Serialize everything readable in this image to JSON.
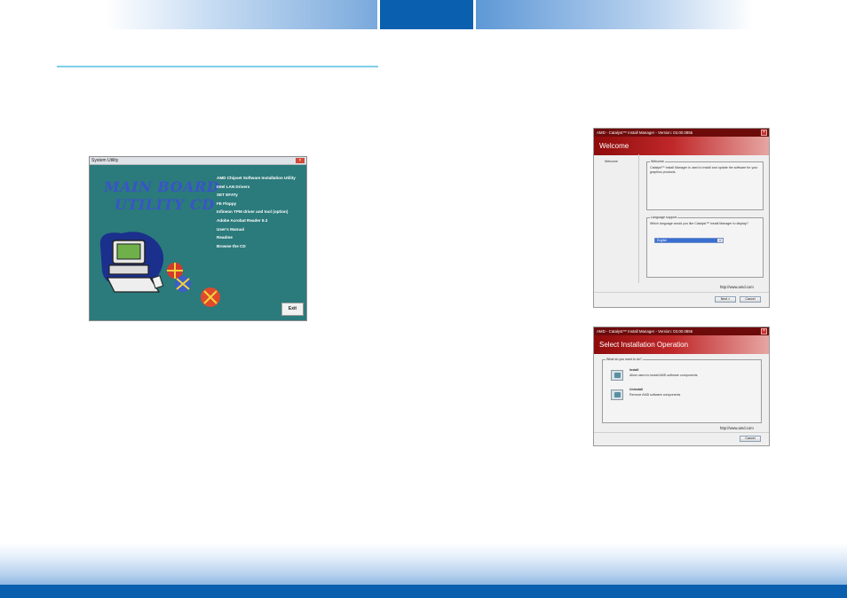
{
  "system_utility": {
    "window_title": "System Utility",
    "close_glyph": "×",
    "cd_title_line1": "MAIN BOARD",
    "cd_title_line2": "UTILITY  CD",
    "menu": [
      "AMD Chipset Software Installation Utility",
      "Intel LAN Drivers",
      "SET EFATy",
      "FE Floppy",
      "Infineon TPM driver and tool (option)",
      "Adobe Acrobat Reader 9.3",
      "User's Manual",
      "Readme",
      "Browse the CD"
    ],
    "exit_label": "Exit",
    "colors": {
      "background": "#2b7a7c",
      "title_text": "#3954c8"
    }
  },
  "welcome_dialog": {
    "titlebar": "AMD - Catalyst™ Install Manager - Version: 03.00.0855",
    "close_glyph": "×",
    "banner": "Welcome",
    "left_step": "Welcome",
    "welcome_group_label": "Welcome",
    "welcome_text": "Catalyst™ Install Manager is used to install and update the software for your graphics products.",
    "language_group_label": "Language support",
    "language_prompt": "Which language would you like Catalyst™ Install Manager to display?",
    "language_value": "English",
    "url": "http://www.amd.com",
    "next_label": "Next >",
    "cancel_label": "Cancel"
  },
  "operation_dialog": {
    "titlebar": "AMD - Catalyst™ Install Manager - Version: 03.00.0855",
    "close_glyph": "×",
    "banner": "Select Installation Operation",
    "group_label": "What do you want to do?",
    "options": [
      {
        "title": "Install",
        "desc": "Allow users to install AMD software components",
        "icon": "install-icon"
      },
      {
        "title": "Uninstall",
        "desc": "Remove AMD software components",
        "icon": "uninstall-icon"
      }
    ],
    "url": "http://www.amd.com",
    "cancel_label": "Cancel"
  },
  "colors": {
    "header_accent": "#0a5fae",
    "rule": "#7fd0e6",
    "amd_red": "#8e0b0b"
  }
}
